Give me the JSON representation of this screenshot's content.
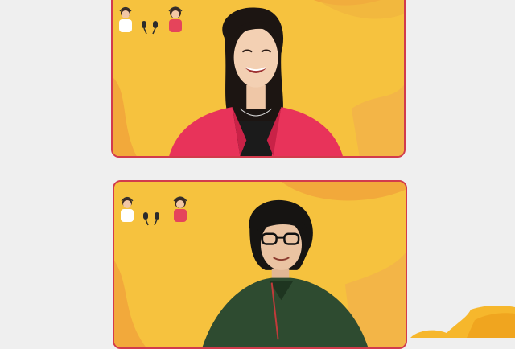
{
  "participants": [
    {
      "id": "speaker-1",
      "shirt_color": "#e8335a",
      "hair_color": "#1c1512"
    },
    {
      "id": "speaker-2",
      "shirt_color": "#2e4b30",
      "hair_color": "#161412"
    }
  ],
  "colors": {
    "tile_border": "#d23b4c",
    "background_yellow": "#f6c23e",
    "wave_orange": "#f2a93b",
    "page_bg": "#efefef"
  },
  "icons": [
    "podcast-illustration-icon",
    "microphone-icon",
    "headset-icon"
  ]
}
